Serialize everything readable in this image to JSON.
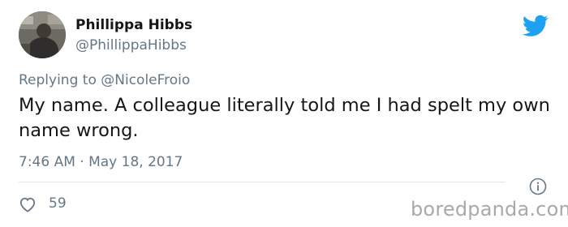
{
  "author": {
    "display_name": "Phillippa Hibbs",
    "handle": "@PhillippaHibbs",
    "avatar_icon": "profile-photo"
  },
  "reply": {
    "prefix": "Replying to ",
    "target": "@NicoleFroio"
  },
  "tweet": {
    "text": "My name. A colleague literally told me I had spelt my own name wrong.",
    "timestamp": "7:46 AM · May 18, 2017"
  },
  "engagement": {
    "likes": "59"
  },
  "watermark": "boredpanda.com",
  "colors": {
    "twitter_blue": "#1da1f2",
    "secondary_text": "#657786",
    "primary_text": "#14171a"
  }
}
